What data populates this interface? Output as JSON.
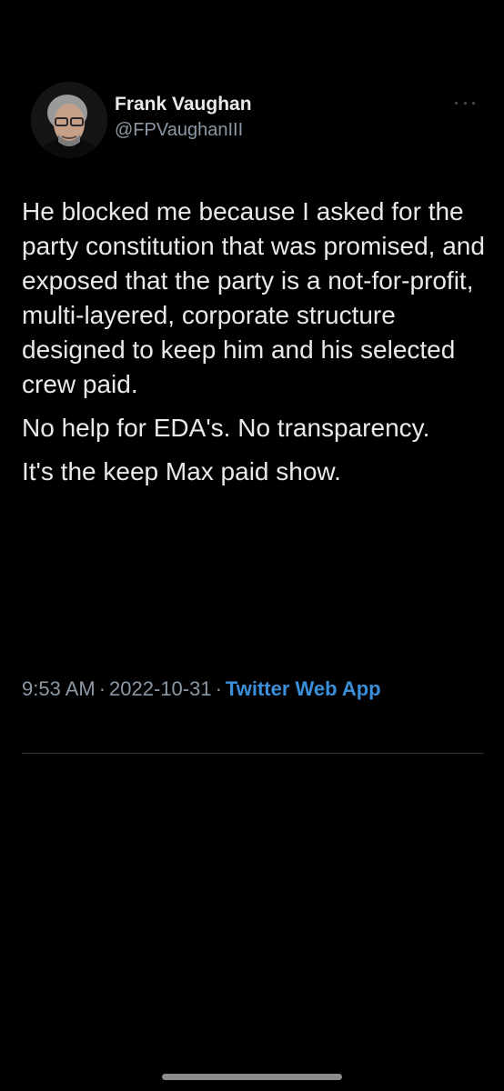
{
  "tweet": {
    "author": {
      "display_name": "Frank Vaughan",
      "handle": "@FPVaughanIII",
      "avatar_icon": "profile-photo"
    },
    "more_icon": "ellipsis-icon",
    "paragraphs": [
      "He blocked me because I asked for the party constitution that was promised, and exposed that the party is a not-for-profit, multi-layered, corporate structure designed to keep him and his selected crew paid.",
      "No help for EDA's.  No transparency.",
      "It's the keep Max paid show."
    ],
    "time": "9:53 AM",
    "separator": "·",
    "date": "2022-10-31",
    "source": "Twitter Web App"
  },
  "colors": {
    "background": "#000000",
    "text": "#e7e9ea",
    "muted": "#8b98a5",
    "link": "#3b8fd9"
  }
}
